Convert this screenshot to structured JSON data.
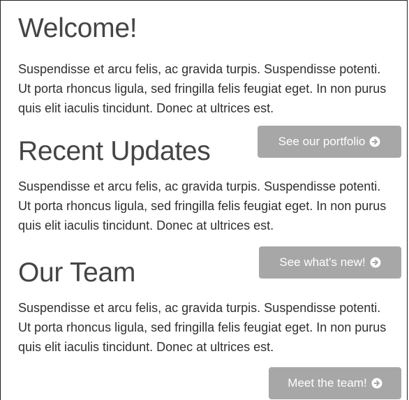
{
  "sections": [
    {
      "heading": "Welcome!",
      "paragraph": "Suspendisse et arcu felis, ac gravida turpis. Suspendisse potenti. Ut porta rhoncus ligula, sed fringilla felis feugiat eget. In non purus quis elit iaculis tincidunt. Donec at ultrices est.",
      "button_label": "See our portfolio"
    },
    {
      "heading": "Recent Updates",
      "paragraph": "Suspendisse et arcu felis, ac gravida turpis. Suspendisse potenti. Ut porta rhoncus ligula, sed fringilla felis feugiat eget. In non purus quis elit iaculis tincidunt. Donec at ultrices est.",
      "button_label": "See what's new!"
    },
    {
      "heading": "Our Team",
      "paragraph": "Suspendisse et arcu felis, ac gravida turpis. Suspendisse potenti. Ut porta rhoncus ligula, sed fringilla felis feugiat eget. In non purus quis elit iaculis tincidunt. Donec at ultrices est.",
      "button_label": "Meet the team!"
    }
  ],
  "icons": {
    "button_icon": "circle-arrow-right-icon"
  },
  "colors": {
    "heading": "#444444",
    "text": "#2f2f2f",
    "button_bg": "#a7a7a7",
    "button_text": "#ffffff"
  }
}
